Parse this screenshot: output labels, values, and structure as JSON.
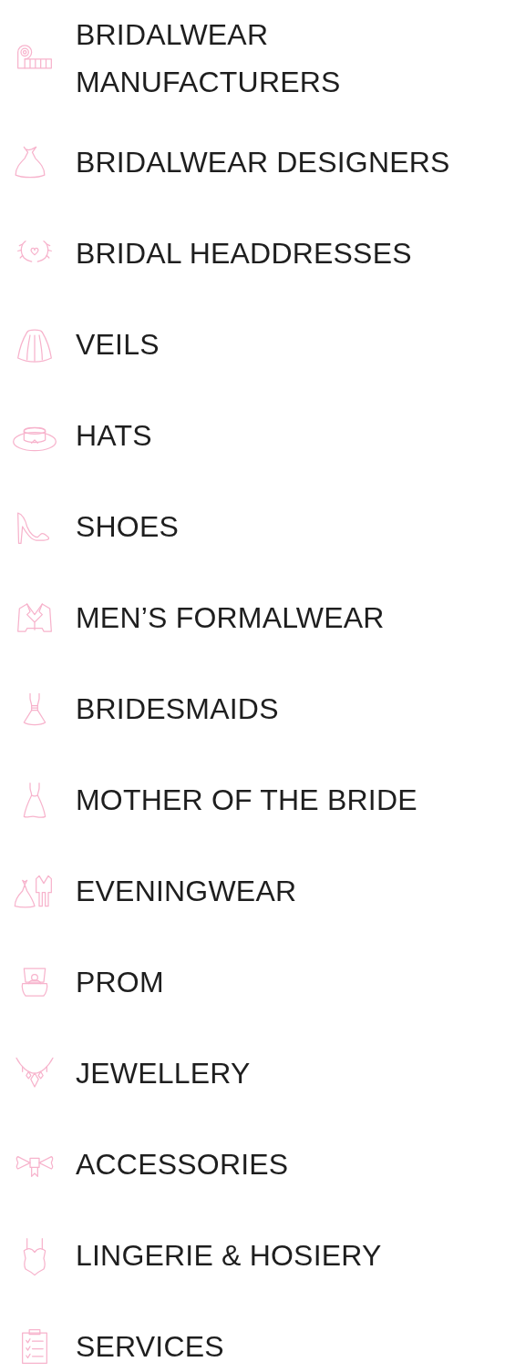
{
  "categories": [
    {
      "label": "BRIDALWEAR MANUFACTURERS",
      "kind": "tape"
    },
    {
      "label": "BRIDALWEAR DESIGNERS",
      "kind": "gown"
    },
    {
      "label": "BRIDAL HEADDRESSES",
      "kind": "wreath"
    },
    {
      "label": "VEILS",
      "kind": "veil"
    },
    {
      "label": "HATS",
      "kind": "hat"
    },
    {
      "label": "SHOES",
      "kind": "shoe"
    },
    {
      "label": "MEN’S FORMALWEAR",
      "kind": "jacket"
    },
    {
      "label": "BRIDESMAIDS",
      "kind": "dress"
    },
    {
      "label": "MOTHER OF THE BRIDE",
      "kind": "longdress"
    },
    {
      "label": "EVENINGWEAR",
      "kind": "couple"
    },
    {
      "label": "PROM",
      "kind": "ringbox"
    },
    {
      "label": "JEWELLERY",
      "kind": "necklace"
    },
    {
      "label": "ACCESSORIES",
      "kind": "bow"
    },
    {
      "label": "LINGERIE & HOSIERY",
      "kind": "bodysuit"
    },
    {
      "label": "SERVICES",
      "kind": "clipboard"
    }
  ]
}
